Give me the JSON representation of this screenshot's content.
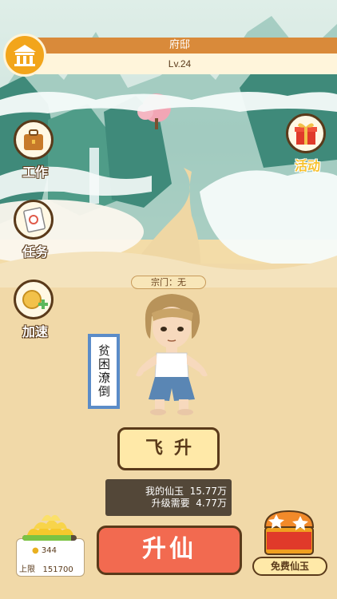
{
  "header": {
    "title": "府邸",
    "level": "Lv.24"
  },
  "side": {
    "work_label": "工作",
    "task_label": "任务",
    "speed_label": "加速",
    "activity_label": "活动"
  },
  "character": {
    "sect_label": "宗门：无",
    "status": "贫困潦倒"
  },
  "feisheng_label": "飞升",
  "jade": {
    "mine_label": "我的仙玉",
    "mine_value": "15.77万",
    "need_label": "升级需要",
    "need_value": "4.77万"
  },
  "gold": {
    "count": "344",
    "limit_label": "上限",
    "limit_value": "151700",
    "progress": 0.9
  },
  "shengxian_label": "升仙",
  "free_jade_label": "免费仙玉",
  "colors": {
    "accent_orange": "#d98a3a",
    "button_red": "#f26a50",
    "cream": "#ffe9a8",
    "dark_brown": "#5a3a1a"
  }
}
